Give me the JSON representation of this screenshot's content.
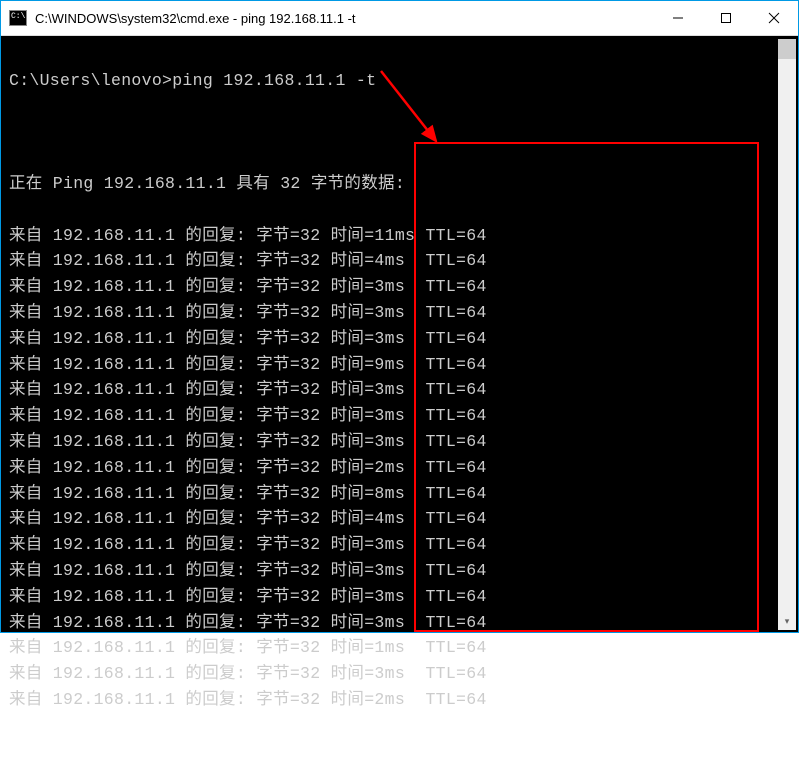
{
  "window": {
    "title": "C:\\WINDOWS\\system32\\cmd.exe - ping  192.168.11.1 -t"
  },
  "terminal": {
    "prompt": "C:\\Users\\lenovo>",
    "command": "ping 192.168.11.1 -t",
    "header": "正在 Ping 192.168.11.1 具有 32 字节的数据:",
    "reply_prefix": "来自 192.168.11.1 的回复: 字节=32 时间=",
    "reply_ttl": " TTL=64",
    "replies": [
      {
        "time": "11ms"
      },
      {
        "time": "4ms",
        "pad": " "
      },
      {
        "time": "3ms",
        "pad": " "
      },
      {
        "time": "3ms",
        "pad": " "
      },
      {
        "time": "3ms",
        "pad": " "
      },
      {
        "time": "9ms",
        "pad": " "
      },
      {
        "time": "3ms",
        "pad": " "
      },
      {
        "time": "3ms",
        "pad": " "
      },
      {
        "time": "3ms",
        "pad": " "
      },
      {
        "time": "2ms",
        "pad": " "
      },
      {
        "time": "8ms",
        "pad": " "
      },
      {
        "time": "4ms",
        "pad": " "
      },
      {
        "time": "3ms",
        "pad": " "
      },
      {
        "time": "3ms",
        "pad": " "
      },
      {
        "time": "3ms",
        "pad": " "
      },
      {
        "time": "3ms",
        "pad": " "
      },
      {
        "time": "1ms",
        "pad": " "
      },
      {
        "time": "3ms",
        "pad": " "
      },
      {
        "time": "2ms",
        "pad": " "
      }
    ]
  },
  "annotation": {
    "highlight_box": true,
    "arrow": true
  }
}
